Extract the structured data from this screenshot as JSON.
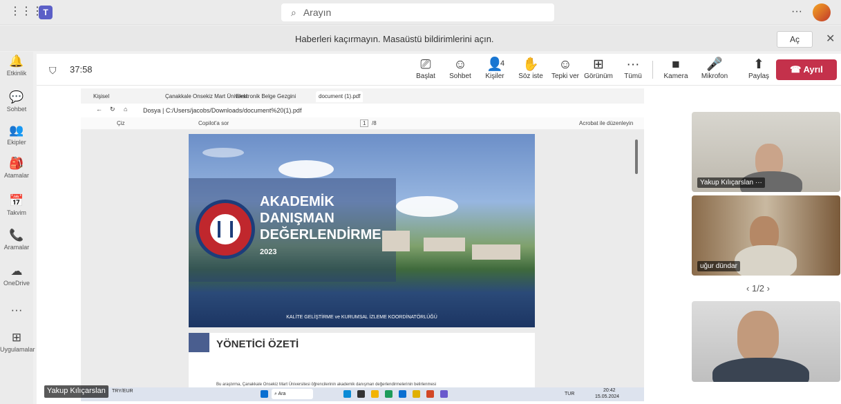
{
  "topbar": {
    "search_placeholder": "Arayın",
    "more": "···"
  },
  "notification": {
    "message": "Haberleri kaçırmayın. Masaüstü bildirimlerini açın.",
    "open_button": "Aç",
    "close": "✕"
  },
  "rail": [
    {
      "label": "Etkinlik",
      "icon": "bell-icon",
      "glyph": "🔔"
    },
    {
      "label": "Sohbet",
      "icon": "chat-icon",
      "glyph": "💬"
    },
    {
      "label": "Ekipler",
      "icon": "teams-icon",
      "glyph": "👥"
    },
    {
      "label": "Atamalar",
      "icon": "assignments-icon",
      "glyph": "🎒"
    },
    {
      "label": "Takvim",
      "icon": "calendar-icon",
      "glyph": "📅"
    },
    {
      "label": "Aramalar",
      "icon": "phone-icon",
      "glyph": "📞"
    },
    {
      "label": "OneDrive",
      "icon": "cloud-icon",
      "glyph": "☁"
    },
    {
      "label": "",
      "icon": "more-icon",
      "glyph": "···"
    },
    {
      "label": "Uygulamalar",
      "icon": "apps-icon",
      "glyph": "⊞"
    }
  ],
  "meeting": {
    "timer": "37:58",
    "tools": [
      {
        "label": "Başlat",
        "icon": "present-icon",
        "glyph": "⎚"
      },
      {
        "label": "Sohbet",
        "icon": "chat-icon",
        "glyph": "☺"
      },
      {
        "label": "Kişiler",
        "icon": "people-icon",
        "glyph": "👤",
        "count": "4"
      },
      {
        "label": "Söz iste",
        "icon": "raise-hand-icon",
        "glyph": "✋"
      },
      {
        "label": "Tepki ver",
        "icon": "reaction-icon",
        "glyph": "☺"
      },
      {
        "label": "Görünüm",
        "icon": "view-icon",
        "glyph": "⊞"
      },
      {
        "label": "Tümü",
        "icon": "more-icon",
        "glyph": "···"
      }
    ],
    "controls": [
      {
        "label": "Kamera",
        "icon": "camera-icon",
        "glyph": "■"
      },
      {
        "label": "Mikrofon",
        "icon": "mic-icon",
        "glyph": "🎤"
      },
      {
        "label": "Paylaş",
        "icon": "share-icon",
        "glyph": "⬆"
      }
    ],
    "leave": "Ayrıl"
  },
  "browser": {
    "tabs": [
      "Kişisel",
      "Çanakkale Onsekiz Mart Üniversi",
      "Elektronik Belge Gezgini",
      "document (1).pdf"
    ],
    "address": "Dosya  |  C:/Users/jacobs/Downloads/document%20(1).pdf",
    "pdf_toolbar": {
      "left": "Çiz",
      "copilot": "Copilot'a sor",
      "page": "1",
      "page_total": "/8",
      "acrobat": "Acrobat ile düzenleyin"
    }
  },
  "document": {
    "title_lines": [
      "AKADEMİK",
      "DANIŞMAN",
      "DEĞERLENDİRME"
    ],
    "year": "2023",
    "footer": "KALİTE GELİŞTİRME ve KURUMSAL İZLEME KOORDİNATÖRLÜĞÜ",
    "seal_text": "ÇANAKKALE ONSEKİZ MART ÜNİVERSİTESİ 1992",
    "section_title": "YÖNETİCİ ÖZETİ",
    "body_snippet": "Bu araştırma, Çanakkale Onsekiz Mart Üniversitesi öğrencilerinin akademik danışman değerlendirmelerinin belirlenmesi"
  },
  "participants": [
    {
      "name": "Yakup Kılıçarslan",
      "more": "···"
    },
    {
      "name": "uğur dündar"
    },
    {
      "name": ""
    }
  ],
  "pager": {
    "label": "1/2"
  },
  "taskbar": {
    "currency": "TRY/EUR",
    "search": "Ara",
    "lang": "TUR",
    "time": "20:42",
    "date": "15.05.2024"
  },
  "speaker_label": "Yakup Kılıçarslan"
}
